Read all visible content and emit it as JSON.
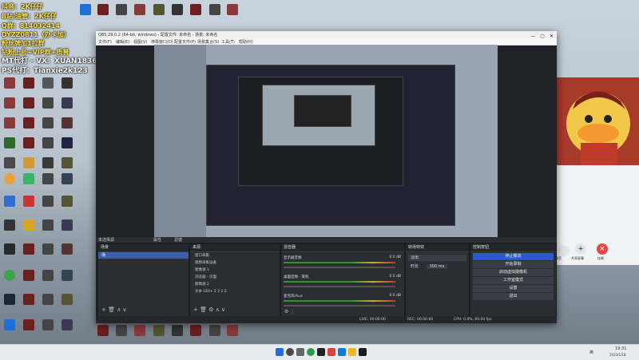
{
  "overlay": {
    "lines": [
      "抖音：2K仔仔",
      "B站/油管：2K仔仔",
      "Q群：814032414",
      "DYZZ0811（办卡加）",
      "粉丝牌加1拉群",
      "钻粉上号+VIP群+质普"
    ],
    "mt_line": "MT代打 - VX：XUAN18364",
    "ps_line": "PS代打：Tianxie2k123"
  },
  "obs": {
    "title": "OBS 29.0.2 (64-bit, windows) - 配置文件: 未命名 - 场景: 未命名",
    "menu": [
      "文件(F)",
      "编辑(E)",
      "视图(V)",
      "停靠窗口(D)",
      "配置文件(P)",
      "场景集合(S)",
      "工具(T)",
      "帮助(H)"
    ],
    "dock_bar_left": "未选择源",
    "dock_bar_props": "属性",
    "dock_bar_filters": "滤镜",
    "scenes": {
      "header": "场景",
      "item": "场"
    },
    "sources": {
      "header": "来源",
      "items": [
        "窗口采集",
        "视频采集设备",
        "图像源 1",
        "浏览器 - 页面",
        "图像源 2",
        "文本 GDI+ 2 2 2 2"
      ]
    },
    "mixer": {
      "header": "混音器",
      "channels": [
        {
          "name": "显示器音频",
          "db": "0.0 dB"
        },
        {
          "name": "桌面音频 - 耳机",
          "db": "0.0 dB"
        },
        {
          "name": "麦克风/Aux",
          "db": "0.0 dB"
        }
      ]
    },
    "transitions": {
      "header": "转场特效",
      "type": "淡出",
      "duration_label": "时长",
      "duration": "300 ms"
    },
    "controls": {
      "header": "控制按钮",
      "buttons": [
        "停止推流",
        "开始录制",
        "启动虚拟摄像机",
        "工作室模式",
        "设置",
        "退出"
      ]
    },
    "status": {
      "live": "LIVE: 00:00:00",
      "rec": "REC: 00:00:00",
      "cpu": "CPU: 0.4%, 60.00 fps"
    }
  },
  "chat": {
    "buttons": [
      "静音",
      "共享屏幕",
      "挂断"
    ]
  },
  "taskbar": {
    "time": "19:31",
    "date": "2023/1/18",
    "lang": "英"
  },
  "colors": {
    "accent": "#2f6fd2",
    "stop_stream": "#2d59c9",
    "hangup": "#e14848"
  }
}
